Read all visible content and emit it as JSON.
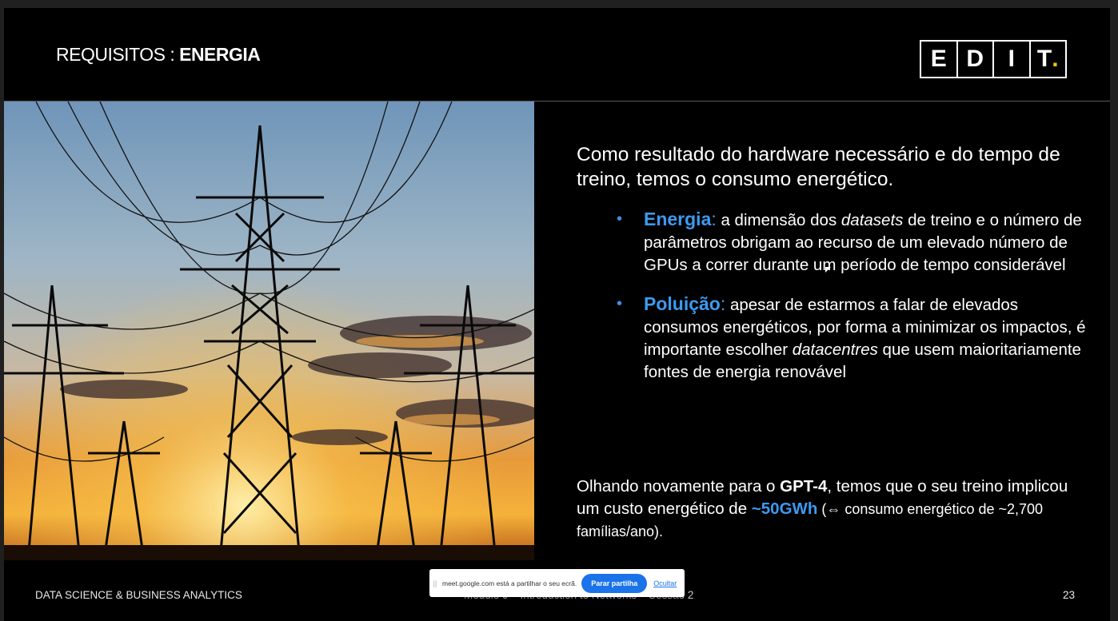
{
  "slide": {
    "title_prefix": "REQUISITOS : ",
    "title_main": "ENERGIA",
    "logo_letters": [
      "E",
      "D",
      "I",
      "T"
    ],
    "logo_dot": ".",
    "intro": "Como resultado do hardware necessário e do tempo de treino, temos o consumo energético.",
    "bullets": [
      {
        "keyword": "Energia",
        "colon": ":",
        "text_1": " a dimensão dos ",
        "emph": "datasets",
        "text_2": " de treino e o número de parâmetros obrigam ao recurso de um elevado número de GPUs a correr durante um período de tempo considerável"
      },
      {
        "keyword": "Poluição",
        "colon": ":",
        "text_1": " apesar de estarmos a falar de elevados consumos energéticos, por forma a minimizar os impactos, é importante escolher ",
        "emph": "datacentres",
        "text_2": " que usem maioritariamente fontes de energia renovável"
      }
    ],
    "outro": {
      "part_1": "Olhando novamente para o ",
      "bold": "GPT-4",
      "part_2": ", temos que o seu treino implicou um custo energético de ",
      "highlight": "~50GWh",
      "part_3": " (⇔ consumo energético de ~2,700 famílias/ano)."
    },
    "footer_left": "DATA SCIENCE & BUSINESS ANALYTICS",
    "footer_mid": "Módulo 9 – Introduction to Networks – Sessão 2",
    "page_number": "23"
  },
  "share_bar": {
    "grip": "||",
    "message": "meet.google.com está a partilhar o seu ecrã.",
    "stop_label": "Parar partilha",
    "hide_label": "Ocultar"
  },
  "colors": {
    "accent_blue": "#3d9af0",
    "logo_dot": "#f5c400",
    "share_button": "#1a73e8"
  }
}
